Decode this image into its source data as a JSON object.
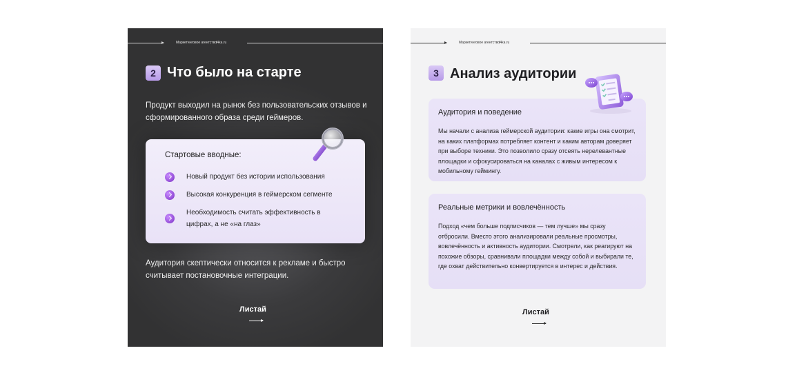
{
  "slide1": {
    "topbar": {
      "agency": "Маркетинговое агентство",
      "site": "t4ka.ru"
    },
    "number": "2",
    "title": "Что было на старте",
    "intro": "Продукт выходил на рынок без пользовательских отзывов и сформированного образа среди геймеров.",
    "card": {
      "title": "Стартовые вводные:",
      "items": [
        {
          "text": "Новый продукт без истории использования"
        },
        {
          "text": "Высокая конкуренция в геймерском сегменте"
        },
        {
          "text": "Необходимость считать эффективность в цифрах, а не «на глаз»"
        }
      ]
    },
    "outro": "Аудитория скептически относится к рекламе и быстро считывает постановочные интеграции.",
    "next_label": "Листай",
    "icons": {
      "illustration": "magnifier-icon",
      "bullet": "chevron-right-icon",
      "next": "arrow-right-icon"
    },
    "colors": {
      "background": "#3b3b3d",
      "card": "#ede8f8",
      "accent": "#9b4fe0"
    }
  },
  "slide2": {
    "topbar": {
      "agency": "Маркетинговое агентство",
      "site": "t4ka.ru"
    },
    "number": "3",
    "title": "Анализ аудитории",
    "cards": [
      {
        "title": "Аудитория и поведение",
        "body": "Мы начали с анализа геймерской аудитории: какие игры она смотрит, на каких платформах потребляет контент и каким авторам доверяет при выборе техники. Это позволило сразу отсеять нерелевантные площадки и сфокусироваться на каналах с живым интересом к мобильному геймингу."
      },
      {
        "title": "Реальные метрики и вовлечённость",
        "body": "Подход «чем больше подписчиков — тем лучше» мы сразу отбросили. Вместо этого анализировали реальные просмотры, вовлечённость и активность аудитории. Смотрели, как реагируют на похожие обзоры, сравнивали площадки между собой и выбирали те, где охват действительно конвертируется в интерес и действия."
      }
    ],
    "next_label": "Листай",
    "icons": {
      "illustration": "clipboard-checklist-icon",
      "next": "arrow-right-icon"
    },
    "colors": {
      "background": "#f3f3f4",
      "card": "#e8e2f7",
      "badge": "#c6b0ee"
    }
  }
}
